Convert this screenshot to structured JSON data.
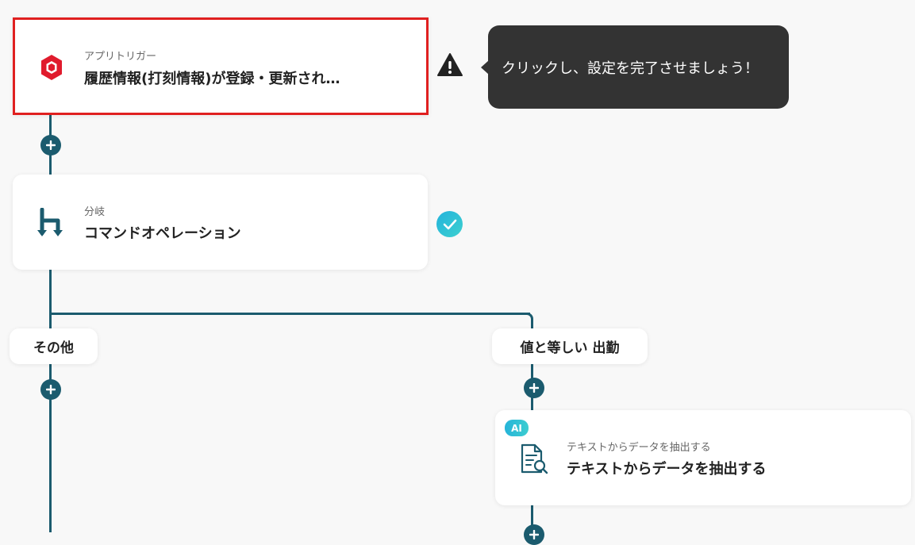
{
  "trigger": {
    "label": "アプリトリガー",
    "title": "履歴情報(打刻情報)が登録・更新され…",
    "border_color": "#e02020",
    "icon": "hexagon-app-icon",
    "icon_color": "#e01b2d"
  },
  "tooltip": {
    "text": "クリックし、設定を完了させましょう！",
    "warning_icon": "warning-icon"
  },
  "branch": {
    "label": "分岐",
    "title": "コマンドオペレーション",
    "icon": "branch-icon",
    "status_icon": "check-icon",
    "status_color": "#2bbfd8"
  },
  "branches": {
    "left_label": "その他",
    "right_label": "値と等しい 出勤"
  },
  "extract": {
    "badge": "AI",
    "label": "テキストからデータを抽出する",
    "title": "テキストからデータを抽出する",
    "icon": "document-search-icon"
  },
  "colors": {
    "line": "#1b5b6e",
    "background": "#f8f8f8"
  }
}
